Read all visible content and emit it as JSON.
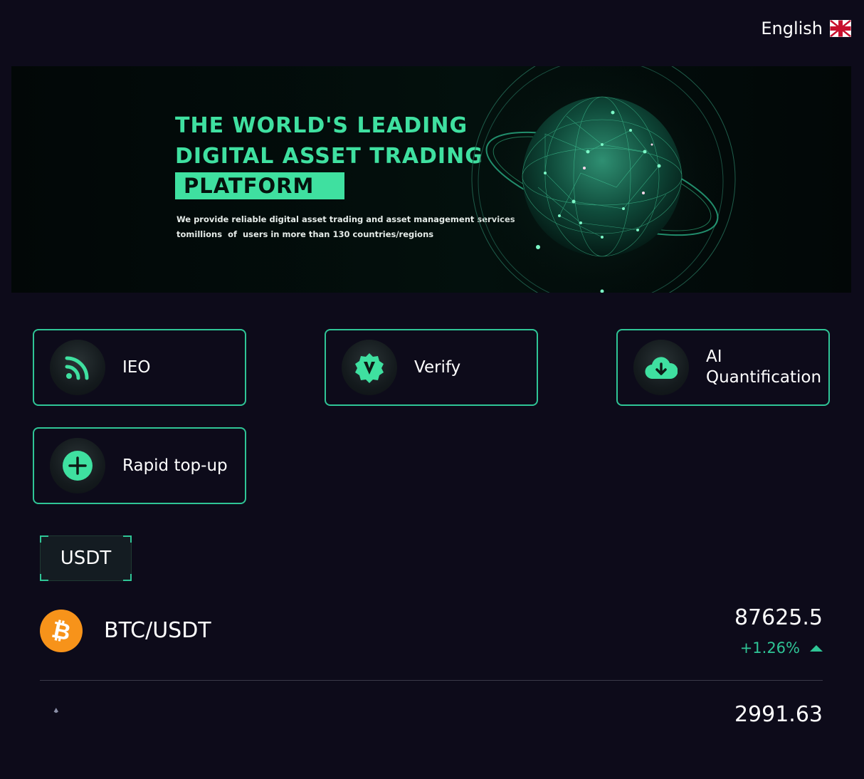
{
  "header": {
    "language": "English",
    "flag_icon": "uk-flag-icon"
  },
  "banner": {
    "title_line1": "THE WORLD'S LEADING",
    "title_line2": "DIGITAL ASSET TRADING",
    "title_highlight": "PLATFORM",
    "subtitle": "We provide reliable digital asset trading and asset management services\ntomillions  of  users in more than 130 countries/regions",
    "accent_color": "#3fe0a0"
  },
  "actions": [
    {
      "label": "IEO",
      "icon": "rss-feed-icon"
    },
    {
      "label": "Verify",
      "icon": "verified-badge-icon"
    },
    {
      "label": "AI\nQuantification",
      "icon": "cloud-download-icon"
    },
    {
      "label": "Rapid top-up",
      "icon": "plus-circle-icon"
    }
  ],
  "market": {
    "active_tab": "USDT",
    "rows": [
      {
        "pair": "BTC/USDT",
        "price": "87625.5",
        "change": "+1.26%",
        "icon": "bitcoin-icon",
        "direction": "up"
      },
      {
        "pair": "",
        "price": "2991.63",
        "change": "",
        "icon": "ethereum-icon",
        "direction": ""
      }
    ],
    "up_color": "#2fc596"
  }
}
